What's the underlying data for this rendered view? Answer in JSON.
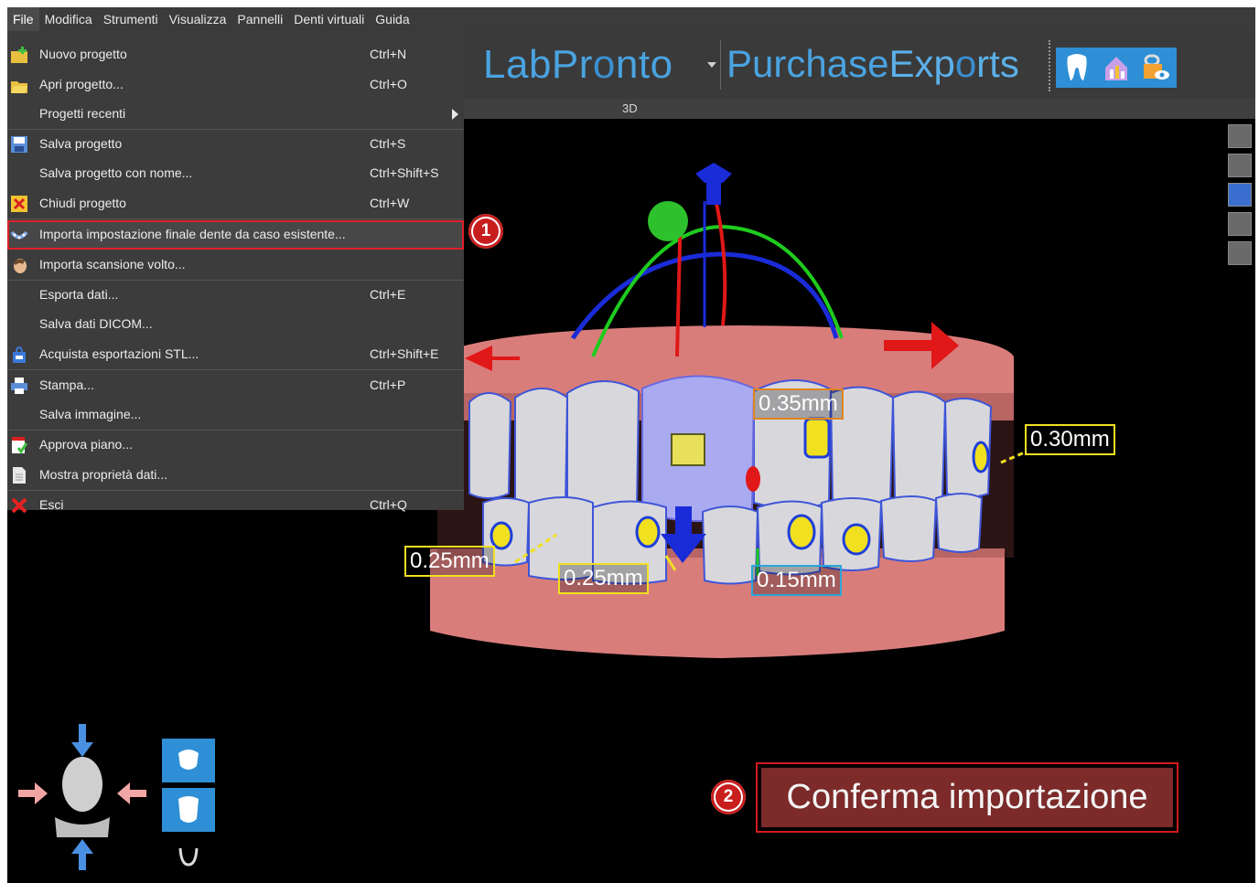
{
  "menubar": {
    "items": [
      "File",
      "Modifica",
      "Strumenti",
      "Visualizza",
      "Pannelli",
      "Denti virtuali",
      "Guida"
    ]
  },
  "header": {
    "logo_lab": "LabPr",
    "logo_o": "o",
    "logo_nto": "nto",
    "purchase": "Purchase",
    "exp": "Exp",
    "exp_o": "o",
    "rts": "rts"
  },
  "viewport_label": "3D",
  "file_menu": {
    "items": [
      {
        "label": "Nuovo progetto",
        "shortcut": "Ctrl+N",
        "icon": "new-project-icon"
      },
      {
        "label": "Apri progetto...",
        "shortcut": "Ctrl+O",
        "icon": "open-folder-icon"
      },
      {
        "label": "Progetti recenti",
        "shortcut": "",
        "icon": ""
      },
      {
        "label": "Salva progetto",
        "shortcut": "Ctrl+S",
        "icon": "save-icon"
      },
      {
        "label": "Salva progetto con nome...",
        "shortcut": "Ctrl+Shift+S",
        "icon": ""
      },
      {
        "label": "Chiudi progetto",
        "shortcut": "Ctrl+W",
        "icon": "close-x-icon"
      },
      {
        "label": "Importa impostazione finale dente da caso esistente...",
        "shortcut": "",
        "icon": "arch-icon"
      },
      {
        "label": "Importa scansione volto...",
        "shortcut": "",
        "icon": "face-icon"
      },
      {
        "label": "Esporta dati...",
        "shortcut": "Ctrl+E",
        "icon": ""
      },
      {
        "label": "Salva dati DICOM...",
        "shortcut": "",
        "icon": ""
      },
      {
        "label": "Acquista esportazioni STL...",
        "shortcut": "Ctrl+Shift+E",
        "icon": "shopping-bag-icon"
      },
      {
        "label": "Stampa...",
        "shortcut": "Ctrl+P",
        "icon": "printer-icon"
      },
      {
        "label": "Salva immagine...",
        "shortcut": "",
        "icon": ""
      },
      {
        "label": "Approva piano...",
        "shortcut": "",
        "icon": "approve-document-icon"
      },
      {
        "label": "Mostra proprietà dati...",
        "shortcut": "",
        "icon": "document-icon"
      },
      {
        "label": "Esci",
        "shortcut": "Ctrl+Q",
        "icon": "exit-x-icon"
      }
    ]
  },
  "callouts": {
    "one": "1",
    "two": "2"
  },
  "measurements": [
    "0.35mm",
    "0.30mm",
    "0.25mm",
    "0.25mm",
    "0.15mm"
  ],
  "confirm_button": "Conferma importazione",
  "colors": {
    "accent_red": "#d31a1a",
    "logo_blue": "#4aa3e0",
    "gum": "#e08a88"
  }
}
